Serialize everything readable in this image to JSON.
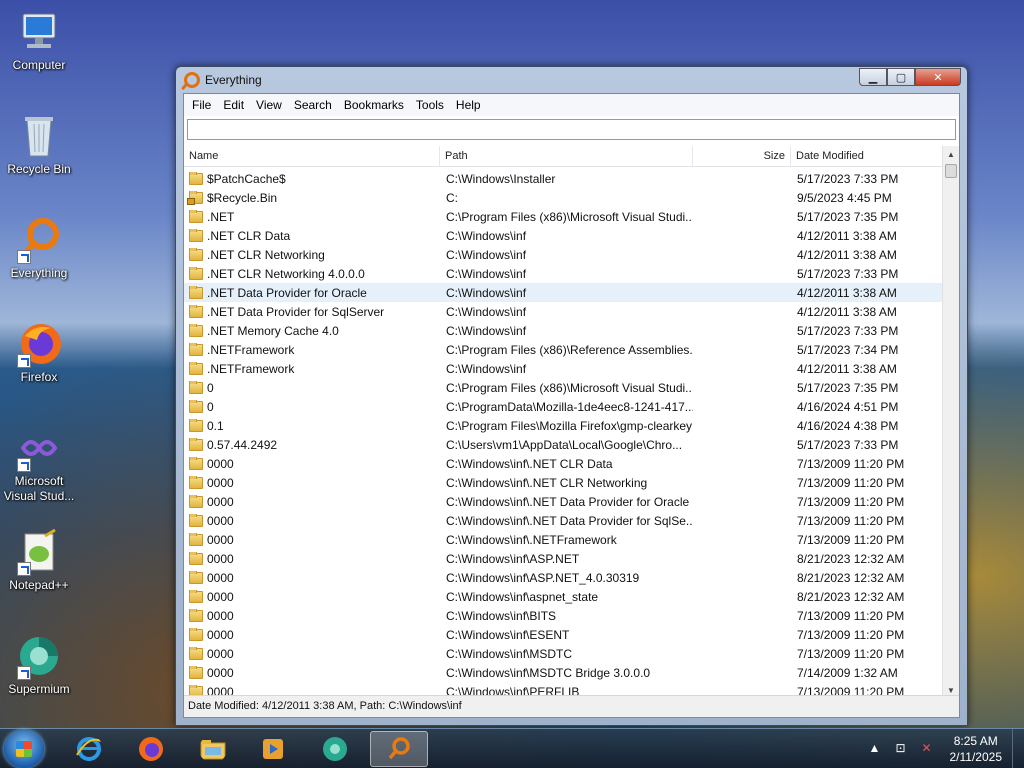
{
  "desktop": {
    "icons": [
      {
        "label": "Computer"
      },
      {
        "label": "Recycle Bin"
      },
      {
        "label": "Everything"
      },
      {
        "label": "Firefox"
      },
      {
        "label": "Microsoft Visual Stud..."
      },
      {
        "label": "Notepad++"
      },
      {
        "label": "Supermium"
      }
    ]
  },
  "window": {
    "title": "Everything",
    "buttons": {
      "minimize": "▁",
      "maximize": "▢",
      "close": "✕"
    },
    "menu": [
      "File",
      "Edit",
      "View",
      "Search",
      "Bookmarks",
      "Tools",
      "Help"
    ],
    "search": {
      "value": "",
      "placeholder": ""
    },
    "columns": {
      "name": "Name",
      "path": "Path",
      "size": "Size",
      "date": "Date Modified"
    },
    "rows": [
      {
        "name": "$PatchCache$",
        "path": "C:\\Windows\\Installer",
        "size": "",
        "date": "5/17/2023 7:33 PM",
        "icon": "folder"
      },
      {
        "name": "$Recycle.Bin",
        "path": "C:",
        "size": "",
        "date": "9/5/2023 4:45 PM",
        "icon": "folder-locked"
      },
      {
        "name": ".NET",
        "path": "C:\\Program Files (x86)\\Microsoft Visual Studi...",
        "size": "",
        "date": "5/17/2023 7:35 PM",
        "icon": "folder"
      },
      {
        "name": ".NET CLR Data",
        "path": "C:\\Windows\\inf",
        "size": "",
        "date": "4/12/2011 3:38 AM",
        "icon": "folder"
      },
      {
        "name": ".NET CLR Networking",
        "path": "C:\\Windows\\inf",
        "size": "",
        "date": "4/12/2011 3:38 AM",
        "icon": "folder"
      },
      {
        "name": ".NET CLR Networking 4.0.0.0",
        "path": "C:\\Windows\\inf",
        "size": "",
        "date": "5/17/2023 7:33 PM",
        "icon": "folder"
      },
      {
        "name": ".NET Data Provider for Oracle",
        "path": "C:\\Windows\\inf",
        "size": "",
        "date": "4/12/2011 3:38 AM",
        "icon": "folder",
        "hover": true
      },
      {
        "name": ".NET Data Provider for SqlServer",
        "path": "C:\\Windows\\inf",
        "size": "",
        "date": "4/12/2011 3:38 AM",
        "icon": "folder"
      },
      {
        "name": ".NET Memory Cache 4.0",
        "path": "C:\\Windows\\inf",
        "size": "",
        "date": "5/17/2023 7:33 PM",
        "icon": "folder"
      },
      {
        "name": ".NETFramework",
        "path": "C:\\Program Files (x86)\\Reference Assemblies...",
        "size": "",
        "date": "5/17/2023 7:34 PM",
        "icon": "folder"
      },
      {
        "name": ".NETFramework",
        "path": "C:\\Windows\\inf",
        "size": "",
        "date": "4/12/2011 3:38 AM",
        "icon": "folder"
      },
      {
        "name": "0",
        "path": "C:\\Program Files (x86)\\Microsoft Visual Studi...",
        "size": "",
        "date": "5/17/2023 7:35 PM",
        "icon": "folder"
      },
      {
        "name": "0",
        "path": "C:\\ProgramData\\Mozilla-1de4eec8-1241-417...",
        "size": "",
        "date": "4/16/2024 4:51 PM",
        "icon": "folder"
      },
      {
        "name": "0.1",
        "path": "C:\\Program Files\\Mozilla Firefox\\gmp-clearkey",
        "size": "",
        "date": "4/16/2024 4:38 PM",
        "icon": "folder"
      },
      {
        "name": "0.57.44.2492",
        "path": "C:\\Users\\vm1\\AppData\\Local\\Google\\Chro...",
        "size": "",
        "date": "5/17/2023 7:33 PM",
        "icon": "folder"
      },
      {
        "name": "0000",
        "path": "C:\\Windows\\inf\\.NET CLR Data",
        "size": "",
        "date": "7/13/2009 11:20 PM",
        "icon": "folder"
      },
      {
        "name": "0000",
        "path": "C:\\Windows\\inf\\.NET CLR Networking",
        "size": "",
        "date": "7/13/2009 11:20 PM",
        "icon": "folder"
      },
      {
        "name": "0000",
        "path": "C:\\Windows\\inf\\.NET Data Provider for Oracle",
        "size": "",
        "date": "7/13/2009 11:20 PM",
        "icon": "folder"
      },
      {
        "name": "0000",
        "path": "C:\\Windows\\inf\\.NET Data Provider for SqlSe...",
        "size": "",
        "date": "7/13/2009 11:20 PM",
        "icon": "folder"
      },
      {
        "name": "0000",
        "path": "C:\\Windows\\inf\\.NETFramework",
        "size": "",
        "date": "7/13/2009 11:20 PM",
        "icon": "folder"
      },
      {
        "name": "0000",
        "path": "C:\\Windows\\inf\\ASP.NET",
        "size": "",
        "date": "8/21/2023 12:32 AM",
        "icon": "folder"
      },
      {
        "name": "0000",
        "path": "C:\\Windows\\inf\\ASP.NET_4.0.30319",
        "size": "",
        "date": "8/21/2023 12:32 AM",
        "icon": "folder"
      },
      {
        "name": "0000",
        "path": "C:\\Windows\\inf\\aspnet_state",
        "size": "",
        "date": "8/21/2023 12:32 AM",
        "icon": "folder"
      },
      {
        "name": "0000",
        "path": "C:\\Windows\\inf\\BITS",
        "size": "",
        "date": "7/13/2009 11:20 PM",
        "icon": "folder"
      },
      {
        "name": "0000",
        "path": "C:\\Windows\\inf\\ESENT",
        "size": "",
        "date": "7/13/2009 11:20 PM",
        "icon": "folder"
      },
      {
        "name": "0000",
        "path": "C:\\Windows\\inf\\MSDTC",
        "size": "",
        "date": "7/13/2009 11:20 PM",
        "icon": "folder"
      },
      {
        "name": "0000",
        "path": "C:\\Windows\\inf\\MSDTC Bridge 3.0.0.0",
        "size": "",
        "date": "7/14/2009 1:32 AM",
        "icon": "folder"
      },
      {
        "name": "0000",
        "path": "C:\\Windows\\inf\\PERFLIB",
        "size": "",
        "date": "7/13/2009 11:20 PM",
        "icon": "folder"
      }
    ],
    "status": "Date Modified: 4/12/2011 3:38 AM, Path: C:\\Windows\\inf"
  },
  "taskbar": {
    "apps": [
      "internet-explorer",
      "firefox",
      "file-explorer",
      "media-player",
      "supermium",
      "everything"
    ],
    "active_app": "everything",
    "clock": {
      "time": "8:25 AM",
      "date": "2/11/2025"
    }
  },
  "colors": {
    "accent": "#e07010",
    "selection": "#e5f0fb"
  }
}
